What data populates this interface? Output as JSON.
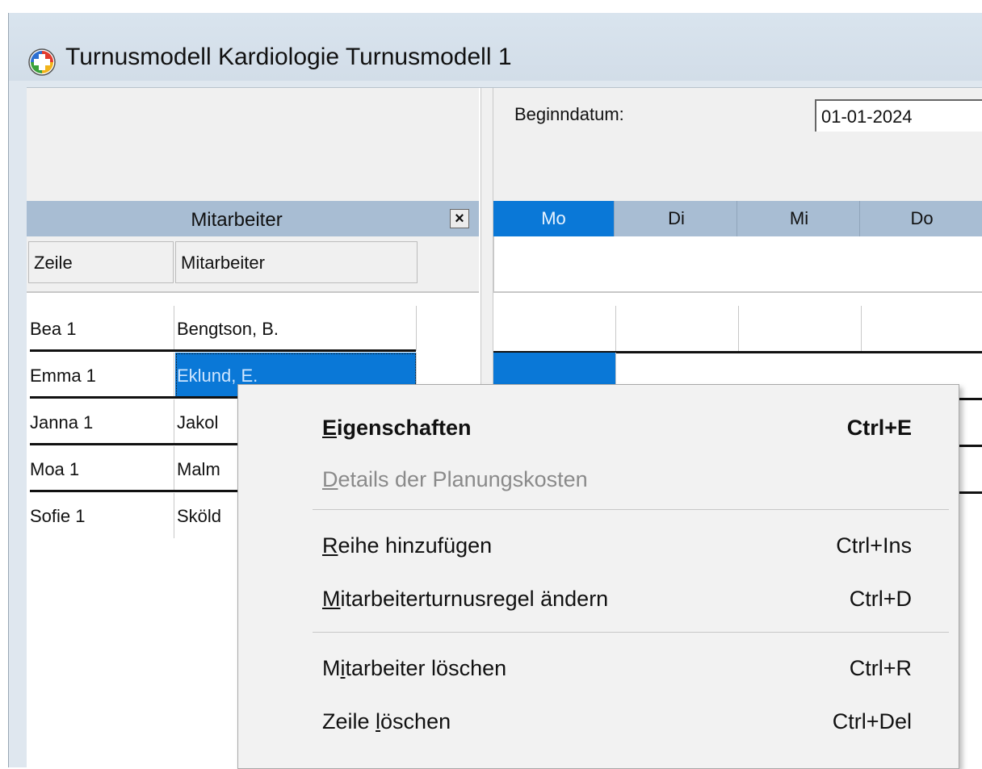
{
  "window": {
    "title": "Turnusmodell Kardiologie Turnusmodell 1"
  },
  "left_panel": {
    "header": "Mitarbeiter",
    "close_glyph": "×",
    "columns": [
      "Zeile",
      "Mitarbeiter"
    ],
    "rows": [
      {
        "zeile": "Bea   1",
        "mitarbeiter": "Bengtson, B."
      },
      {
        "zeile": "Emma   1",
        "mitarbeiter": "Eklund, E."
      },
      {
        "zeile": "Janna   1",
        "mitarbeiter": "Jakol"
      },
      {
        "zeile": "Moa   1",
        "mitarbeiter": "Malm"
      },
      {
        "zeile": "Sofie   1",
        "mitarbeiter": "Sköld"
      }
    ],
    "selected_row": 1
  },
  "right_panel": {
    "begin_label": "Beginndatum:",
    "begin_value": "01-01-2024",
    "days": [
      "Mo",
      "Di",
      "Mi",
      "Do"
    ],
    "active_day": "Mo"
  },
  "context_menu": {
    "items": [
      {
        "label_underlined": "E",
        "label_rest": "igenschaften",
        "label_prefix": "",
        "shortcut": "Ctrl+E",
        "bold": true,
        "disabled": false
      },
      {
        "label_underlined": "D",
        "label_rest": "etails der Planungskosten",
        "label_prefix": "",
        "shortcut": "",
        "bold": false,
        "disabled": true
      },
      {
        "label_underlined": "R",
        "label_rest": "eihe hinzufügen",
        "label_prefix": "",
        "shortcut": "Ctrl+Ins",
        "bold": false,
        "disabled": false
      },
      {
        "label_underlined": "M",
        "label_rest": "itarbeiterturnusregel ändern",
        "label_prefix": "",
        "shortcut": "Ctrl+D",
        "bold": false,
        "disabled": false
      },
      {
        "label_underlined": "i",
        "label_rest": "tarbeiter löschen",
        "label_prefix": "M",
        "shortcut": "Ctrl+R",
        "bold": false,
        "disabled": false
      },
      {
        "label_underlined": "l",
        "label_rest": "öschen",
        "label_prefix": "Zeile ",
        "shortcut": "Ctrl+Del",
        "bold": false,
        "disabled": false
      }
    ]
  },
  "colors": {
    "selection": "#0a78d7",
    "header": "#a8bdd3"
  },
  "icons": {
    "app": "app-logo-icon",
    "close": "close-icon"
  }
}
